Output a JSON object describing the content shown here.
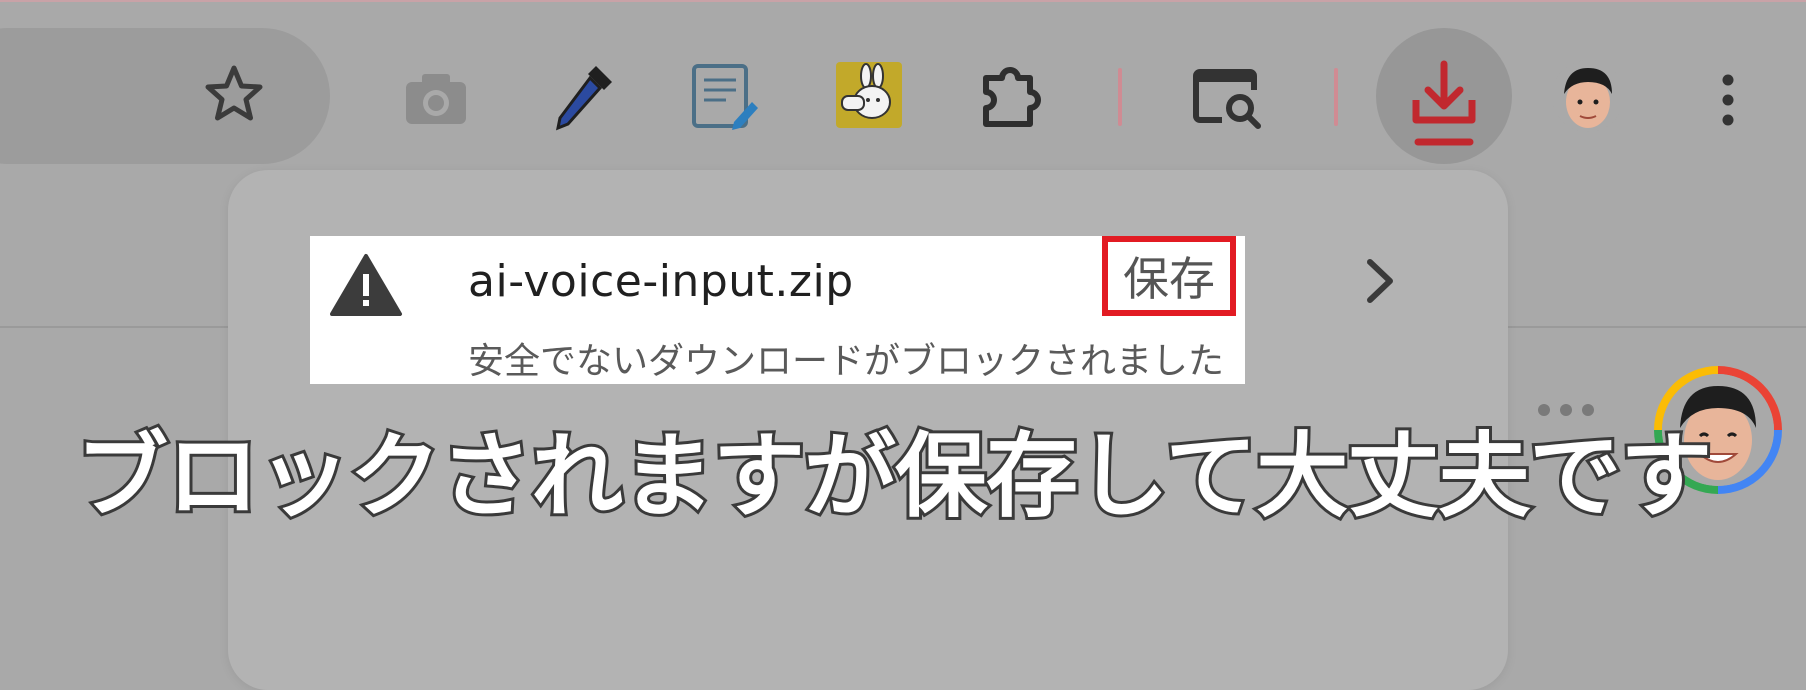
{
  "toolbar": {
    "icons": [
      "star-icon",
      "camera-icon",
      "eyedropper-icon",
      "notes-icon",
      "rabbit-extension-icon",
      "puzzle-extensions-icon",
      "tab-search-icon",
      "download-icon",
      "profile-avatar",
      "menu-icon"
    ],
    "accent_color": "#c1282e"
  },
  "download": {
    "filename": "ai-voice-input.zip",
    "status": "安全でないダウンロードがブロックされました",
    "save_label": "保存",
    "highlight_color": "#e21b23"
  },
  "caption": {
    "text": "ブロックされますが保存して大丈夫です"
  }
}
